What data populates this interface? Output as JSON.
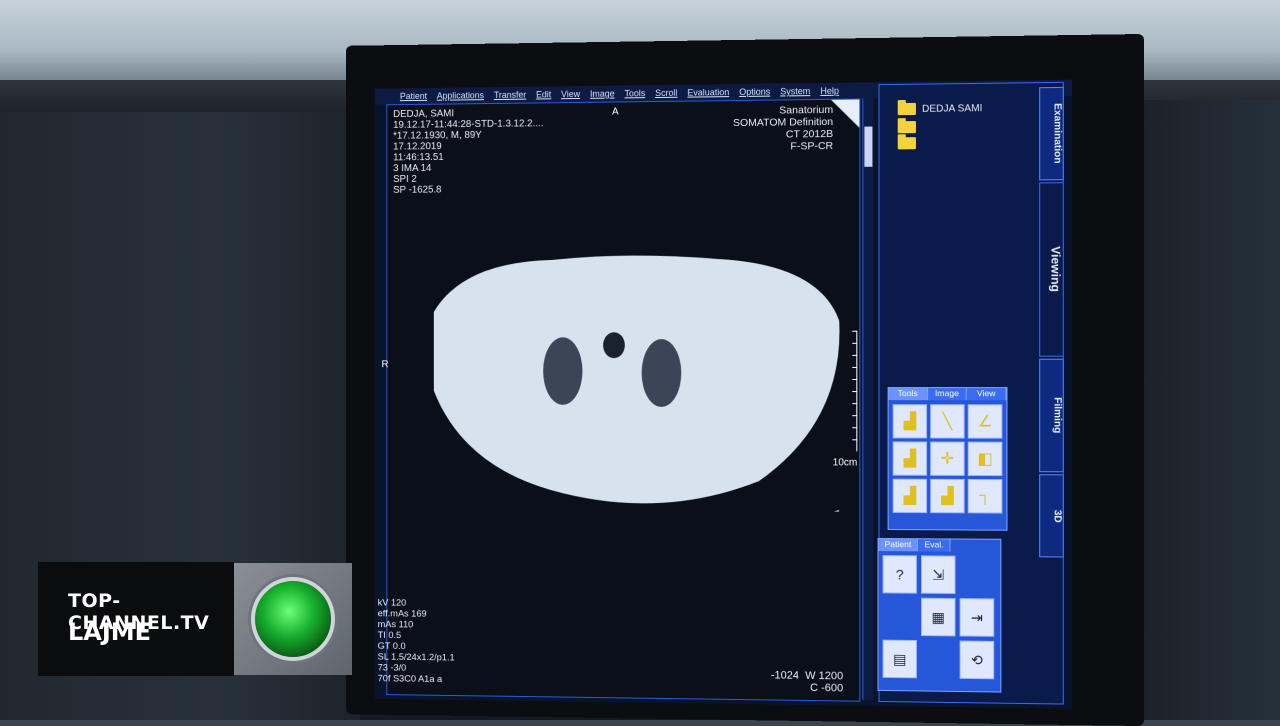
{
  "menu": [
    "Patient",
    "Applications",
    "Transfer",
    "Edit",
    "View",
    "Image",
    "Tools",
    "Scroll",
    "Evaluation",
    "Options",
    "System",
    "Help"
  ],
  "overlay_top_left": [
    "DEDJA, SAMI",
    "19.12.17-11:44:28-STD-1.3.12.2....",
    "*17.12.1930, M, 89Y",
    "17.12.2019",
    "11:46:13.51",
    "3 IMA 14",
    "SPI 2",
    "SP -1625.8"
  ],
  "overlay_top_right": [
    "Sanatorium",
    "SOMATOM Definition",
    "CT 2012B",
    "F-SP-CR"
  ],
  "overlay_bottom_left": [
    "kV 120",
    "eff.mAs 169",
    "mAs 110",
    "TI 0.5",
    "GT 0.0",
    "SL 1.5/24x1.2/p1.1",
    "73 -3/0",
    "70f S3C0 A1a a"
  ],
  "window": {
    "width": "W 1200",
    "center": "C -600",
    "level": "-1024"
  },
  "orientation": {
    "anterior": "A",
    "right": "R"
  },
  "scale": "10cm",
  "panel": {
    "folder": "DEDJA SAMI",
    "tabs": [
      "Examination",
      "Viewing",
      "Filming",
      "3D"
    ],
    "tools_tabs": [
      "Tools",
      "Image",
      "View"
    ],
    "pe_tabs": [
      "Patient",
      "Eval."
    ]
  },
  "broadcast": {
    "site": "TOP-CHANNEL.TV",
    "section": "LAJME"
  },
  "colors": {
    "accent": "#2757d9",
    "folder": "#f2d33c",
    "emblem": "#18b02e"
  }
}
